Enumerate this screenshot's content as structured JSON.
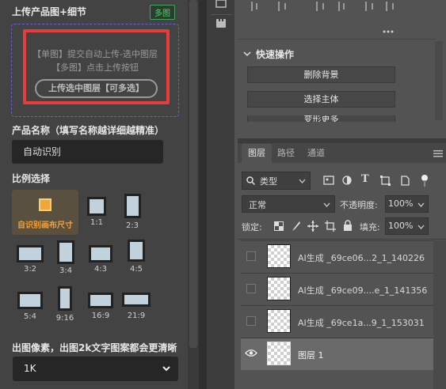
{
  "plugin": {
    "upload_title": "上传产品图+细节",
    "upload_badge": "多图",
    "upload_line1": "【单图】提交自动上传-选中图层",
    "upload_line2": "【多图】点击上传按钮",
    "upload_button": "上传选中图层【可多选】",
    "name_title": "产品名称（填写名称越详细越精准）",
    "name_value": "自动识别",
    "ratio_title": "比例选择",
    "ratio_auto_label": "自识别画布尺寸",
    "ratios": [
      "1:1",
      "2:3",
      "3:2",
      "3:4",
      "4:3",
      "4:5",
      "5:4",
      "9:16",
      "16:9",
      "21:9"
    ],
    "res_title": "出图像素，出图2k文字图案都会更清晰",
    "res_value": "1K"
  },
  "photoshop": {
    "quick_title": "快速操作",
    "quick_buttons": [
      "删除背景",
      "选择主体",
      "变形更多"
    ],
    "tabs": [
      "图层",
      "路径",
      "通道"
    ],
    "kind_label": "类型",
    "blend_mode": "正常",
    "opacity_label": "不透明度:",
    "opacity_value": "100%",
    "lock_label": "锁定:",
    "fill_label": "填充:",
    "fill_value": "100%",
    "layers": [
      {
        "name": "AI生成 _69ce06...2_1_140226",
        "visible": false,
        "selected": false
      },
      {
        "name": "AI生成 _69ce09....e_1_141356",
        "visible": false,
        "selected": false
      },
      {
        "name": "AI生成 _69ce1a...9_1_153031",
        "visible": false,
        "selected": false
      },
      {
        "name": "图层 1",
        "visible": true,
        "selected": true
      }
    ]
  }
}
